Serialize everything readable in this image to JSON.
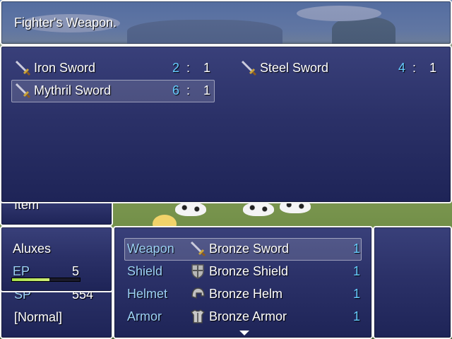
{
  "help": {
    "text": "Fighter's Weapon."
  },
  "weapon_list": [
    {
      "name": "Iron Sword",
      "a": "2",
      "sep": ":",
      "b": "1",
      "icon": "sword-icon"
    },
    {
      "name": "Steel Sword",
      "a": "4",
      "sep": ":",
      "b": "1",
      "icon": "sword-icon"
    },
    {
      "name": "Mythril Sword",
      "a": "6",
      "sep": ":",
      "b": "1",
      "icon": "sword-icon"
    }
  ],
  "behind": {
    "item_label": "Item",
    "sp_label": "SP",
    "sp_value": "554",
    "state": "[Normal]"
  },
  "actor": {
    "name": "Aluxes",
    "ep_label": "EP",
    "ep_value": "5",
    "ep_fraction": 0.55
  },
  "equip": [
    {
      "slot": "Weapon",
      "item": "Bronze Sword",
      "count": "1",
      "icon": "sword-icon"
    },
    {
      "slot": "Shield",
      "item": "Bronze Shield",
      "count": "1",
      "icon": "shield-icon"
    },
    {
      "slot": "Helmet",
      "item": "Bronze Helm",
      "count": "1",
      "icon": "helmet-icon"
    },
    {
      "slot": "Armor",
      "item": "Bronze Armor",
      "count": "1",
      "icon": "armor-icon"
    }
  ],
  "colors": {
    "window_top": "#39407a",
    "window_bottom": "#1e2457",
    "number": "#66ccff",
    "system": "#9cd0f5",
    "gauge": "#a6e04a"
  }
}
